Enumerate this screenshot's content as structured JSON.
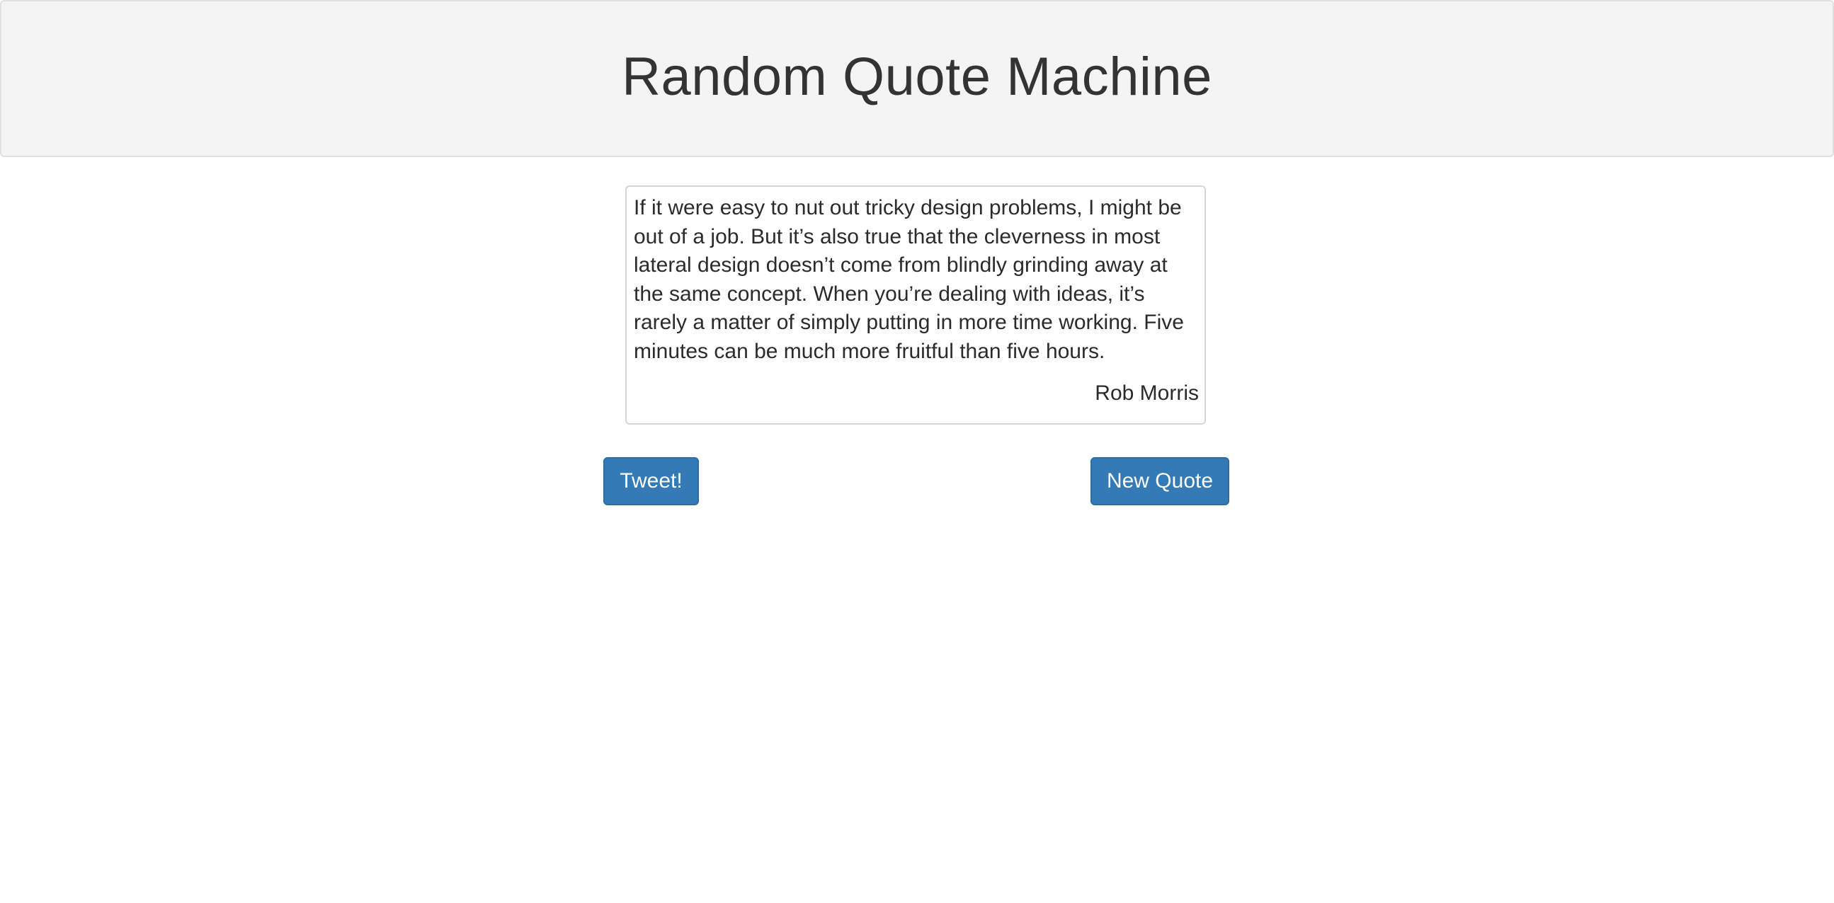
{
  "header": {
    "title": "Random Quote Machine"
  },
  "quote": {
    "text": "If it were easy to nut out tricky design problems, I might be out of a job. But it’s also true that the cleverness in most lateral design doesn’t come from blindly grinding away at the same concept. When you’re dealing with ideas, it’s rarely a matter of simply putting in more time working. Five minutes can be much more fruitful than five hours.",
    "author": "Rob Morris"
  },
  "actions": {
    "tweet_label": "Tweet!",
    "new_quote_label": "New Quote"
  },
  "colors": {
    "button_bg": "#337ab7",
    "button_border": "#2e6da4",
    "jumbotron_bg": "#f4f4f4",
    "text": "#333333"
  }
}
